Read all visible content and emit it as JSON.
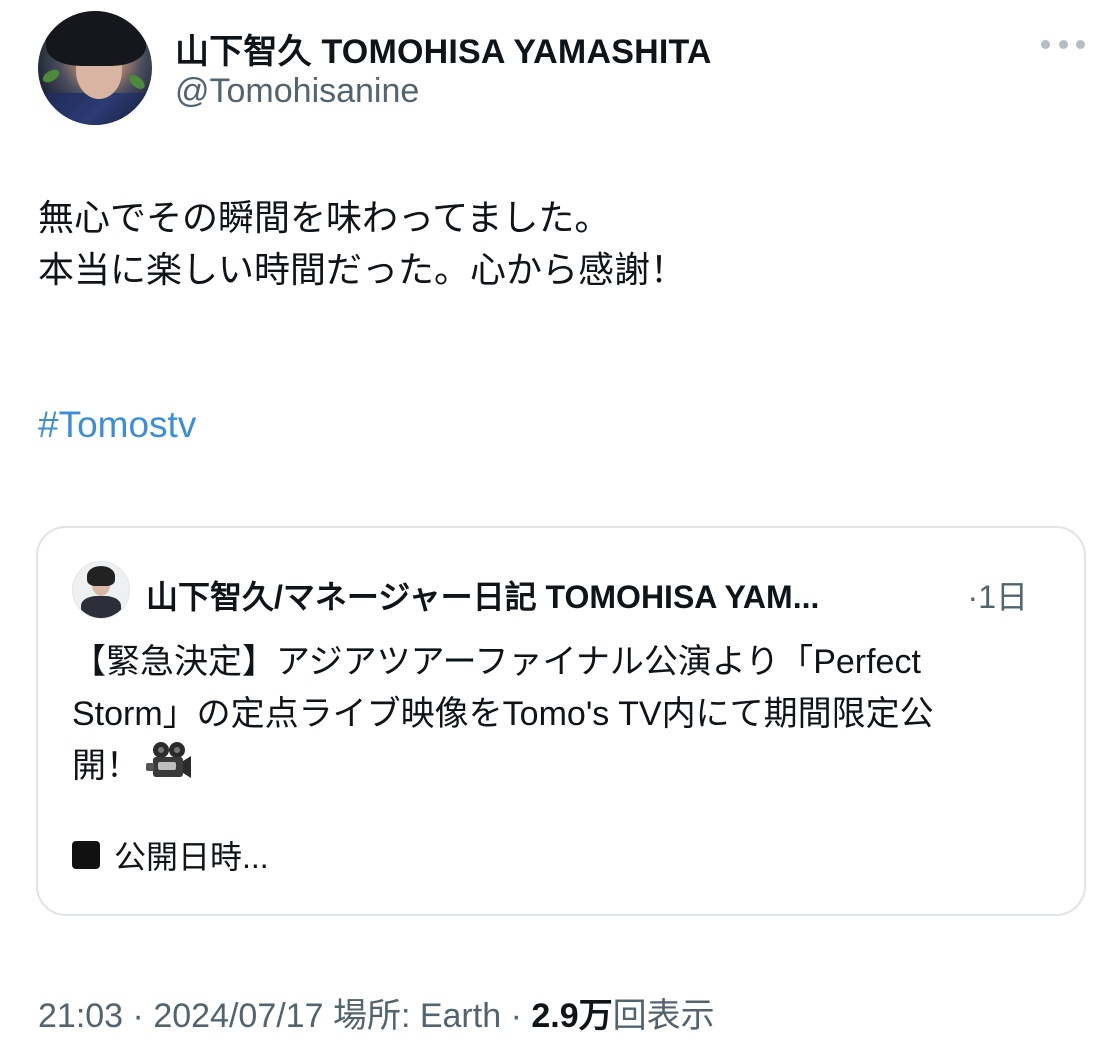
{
  "author": {
    "display_name": "山下智久 TOMOHISA YAMASHITA",
    "handle": "@Tomohisanine"
  },
  "tweet": {
    "lines": [
      "無心でその瞬間を味わってました。",
      "本当に楽しい時間だった。心から感謝！"
    ],
    "hashtag": "#Tomostv"
  },
  "quote": {
    "display_name": "山下智久/マネージャー日記 TOMOHISA YAM...",
    "meta": "·1日",
    "lines": [
      "【緊急決定】アジアツアーファイナル公演より「Perfect",
      "Storm」の定点ライブ映像をTomo's TV内にて期間限定公",
      "開！"
    ],
    "more_text": "公開日時..."
  },
  "footer": {
    "time": "21:03",
    "sep1": "·",
    "date": "2024/07/17",
    "location": "場所: Earth",
    "sep2": "·",
    "views_count": "2.9万",
    "views_label": "回表示"
  },
  "icons": {
    "more": "more-horizontal-icon",
    "camera": "movie-camera-icon",
    "square": "black-square-icon"
  },
  "colors": {
    "hashtag": "#3b8fd6",
    "secondary_text": "#536471",
    "primary_text": "#0f1419",
    "card_border": "#dfe4e8"
  }
}
